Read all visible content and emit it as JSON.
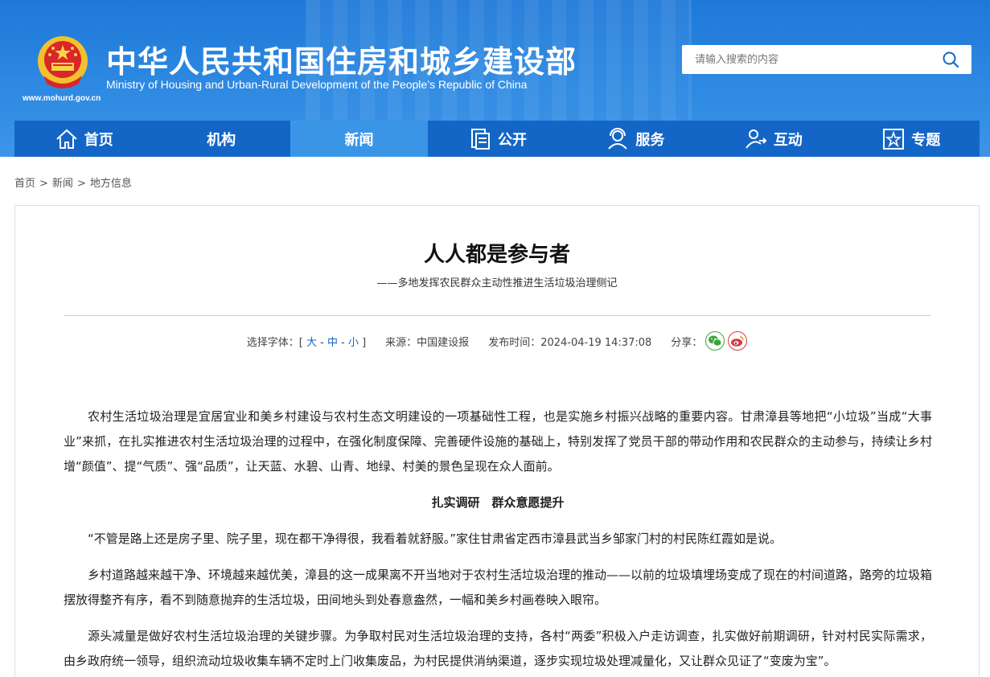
{
  "header": {
    "title": "中华人民共和国住房和城乡建设部",
    "subtitle": "Ministry of Housing and Urban-Rural Development of the People’s Republic of China",
    "url": "www.mohurd.gov.cn",
    "search_placeholder": "请输入搜索的内容"
  },
  "nav": {
    "items": [
      {
        "label": "首页",
        "icon": "home-icon"
      },
      {
        "label": "机构",
        "icon": ""
      },
      {
        "label": "新闻",
        "icon": "",
        "active": true
      },
      {
        "label": "公开",
        "icon": "document-icon"
      },
      {
        "label": "服务",
        "icon": "service-icon"
      },
      {
        "label": "互动",
        "icon": "interaction-icon"
      },
      {
        "label": "专题",
        "icon": "star-icon"
      }
    ]
  },
  "breadcrumb": {
    "items": [
      "首页",
      "新闻",
      "地方信息"
    ],
    "separator": ">"
  },
  "article": {
    "title": "人人都是参与者",
    "subtitle": "——多地发挥农民群众主动性推进生活垃圾治理侧记",
    "meta": {
      "font_label": "选择字体：[",
      "font_large": "大",
      "font_medium": "中",
      "font_small": "小",
      "font_dash": "-",
      "font_close": "]",
      "source": "来源：中国建设报",
      "publish_time": "发布时间：2024-04-19 14:37:08",
      "share_label": "分享："
    },
    "paragraphs": [
      "农村生活垃圾治理是宜居宜业和美乡村建设与农村生态文明建设的一项基础性工程，也是实施乡村振兴战略的重要内容。甘肃漳县等地把“小垃圾”当成“大事业”来抓，在扎实推进农村生活垃圾治理的过程中，在强化制度保障、完善硬件设施的基础上，特别发挥了党员干部的带动作用和农民群众的主动参与，持续让乡村增“颜值”、提“气质”、强“品质”，让天蓝、水碧、山青、地绿、村美的景色呈现在众人面前。",
      "扎实调研　群众意愿提升",
      "“不管是路上还是房子里、院子里，现在都干净得很，我看着就舒服。”家住甘肃省定西市漳县武当乡邹家门村的村民陈红霞如是说。",
      "乡村道路越来越干净、环境越来越优美，漳县的这一成果离不开当地对于农村生活垃圾治理的推动——以前的垃圾填埋场变成了现在的村间道路，路旁的垃圾箱摆放得整齐有序，看不到随意抛弃的生活垃圾，田间地头到处春意盎然，一幅和美乡村画卷映入眼帘。",
      "源头减量是做好农村生活垃圾治理的关键步骤。为争取村民对生活垃圾治理的支持，各村“两委”积极入户走访调查，扎实做好前期调研，针对村民实际需求，由乡政府统一领导，组织流动垃圾收集车辆不定时上门收集废品，为村民提供消纳渠道，逐步实现垃圾处理减量化，又让群众见证了“变废为宝”。"
    ]
  },
  "colors": {
    "header_blue": "#2a86e0",
    "nav_blue": "#1466c6",
    "nav_active": "#3b95e6",
    "wechat_green": "#3aa63a",
    "weibo_red": "#d8383a"
  }
}
